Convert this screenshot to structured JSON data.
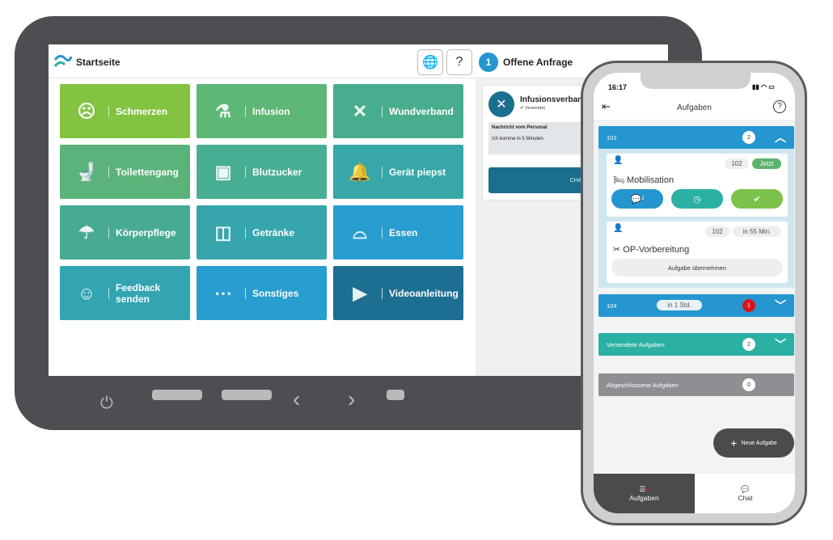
{
  "header": {
    "title": "Startseite",
    "globe_icon": "globe-icon",
    "help_icon": "help-icon",
    "open_count": "1",
    "open_label": "Offene Anfrage"
  },
  "tiles": [
    {
      "label": "Schmerzen",
      "icon": "pain-face-icon",
      "color": "#82c341"
    },
    {
      "label": "Infusion",
      "icon": "infusion-icon",
      "color": "#5eb776"
    },
    {
      "label": "Wundverband",
      "icon": "bandage-icon",
      "color": "#48ad8e"
    },
    {
      "label": "Toilettengang",
      "icon": "toilet-icon",
      "color": "#5bb379"
    },
    {
      "label": "Blutzucker",
      "icon": "glucose-meter-icon",
      "color": "#48ae93"
    },
    {
      "label": "Gerät piepst",
      "icon": "bell-icon",
      "color": "#37a7a9"
    },
    {
      "label": "Körperpflege",
      "icon": "shower-icon",
      "color": "#47aa93"
    },
    {
      "label": "Getränke",
      "icon": "glass-icon",
      "color": "#37a5ac"
    },
    {
      "label": "Essen",
      "icon": "cloche-icon",
      "color": "#289dcf"
    },
    {
      "label": "Feedback senden",
      "icon": "feedback-icon",
      "color": "#33a4b2"
    },
    {
      "label": "Sonstiges",
      "icon": "more-icon",
      "color": "#289dd0"
    },
    {
      "label": "Videoanleitung",
      "icon": "video-icon",
      "color": "#1d6f92"
    }
  ],
  "request": {
    "title": "Infusionsverband",
    "status": "Versendet",
    "msg_heading": "Nachricht vom Personal",
    "msg_text": "Ich komme in 5 Minuten.",
    "chat_button": "CHAT"
  },
  "phone": {
    "time": "16:17",
    "title": "Aufgaben",
    "groups": [
      {
        "room": "102",
        "count": "2",
        "color": "#2596cf",
        "expanded": true
      },
      {
        "room": "104",
        "time": "in 1 Std.",
        "count": "1",
        "color": "#2596cf",
        "alert": true
      },
      {
        "label": "Versendete Aufgaben",
        "count": "2",
        "color": "#2bb0a4"
      },
      {
        "label": "Abgeschlossene Aufgaben",
        "count": "0",
        "color": "#8e8f93"
      }
    ],
    "tasks": [
      {
        "name": "Mobilisation",
        "room": "102",
        "time": "Jetzt",
        "chat_count": "2"
      },
      {
        "name": "OP-Vorbereitung",
        "room": "102",
        "time": "in 55 Min.",
        "action": "Aufgabe übernehmen"
      }
    ],
    "fab": "Neue Aufgabe",
    "tabs": [
      {
        "label": "Aufgaben",
        "active": true
      },
      {
        "label": "Chat"
      }
    ]
  }
}
